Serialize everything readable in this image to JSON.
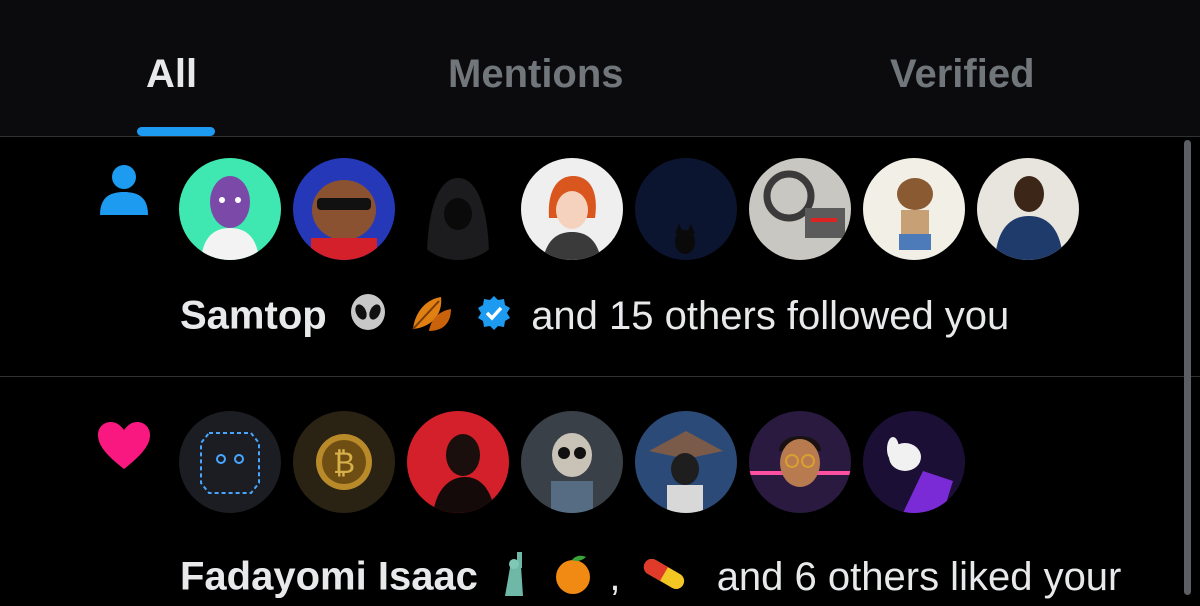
{
  "tabs": [
    {
      "label": "All",
      "active": true
    },
    {
      "label": "Mentions",
      "active": false
    },
    {
      "label": "Verified",
      "active": false
    }
  ],
  "notifications": [
    {
      "icon": "person-icon",
      "icon_color": "#1d9bf0",
      "avatar_count": 8,
      "name": "Samtop",
      "emojis": [
        "alien-emoji",
        "fallen-leaf-emoji",
        "verified-badge-icon"
      ],
      "text": "and 15 others followed you"
    },
    {
      "icon": "heart-icon",
      "icon_color": "#f91880",
      "avatar_count": 7,
      "name": "Fadayomi Isaac",
      "emojis": [
        "statue-of-liberty-emoji",
        "tangerine-emoji",
        "pill-emoji"
      ],
      "separator": ",",
      "text": "and 6 others liked your"
    }
  ],
  "colors": {
    "accent": "#1d9bf0",
    "like": "#f91880",
    "background": "#000000",
    "text": "#e7e9ea",
    "muted": "#71767b"
  }
}
